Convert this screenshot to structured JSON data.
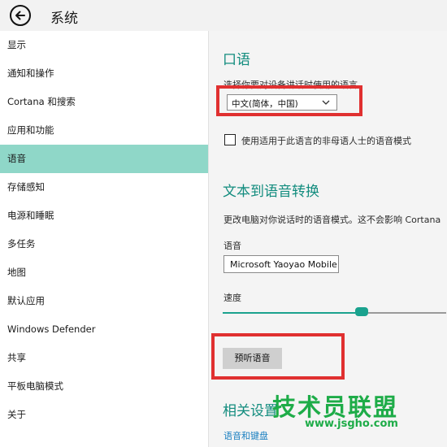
{
  "app": {
    "title": "系统"
  },
  "sidebar": {
    "items": [
      {
        "label": "显示"
      },
      {
        "label": "通知和操作"
      },
      {
        "label": "Cortana 和搜索"
      },
      {
        "label": "应用和功能"
      },
      {
        "label": "语音",
        "selected": true
      },
      {
        "label": "存储感知"
      },
      {
        "label": "电源和睡眠"
      },
      {
        "label": "多任务"
      },
      {
        "label": "地图"
      },
      {
        "label": "默认应用"
      },
      {
        "label": "Windows Defender"
      },
      {
        "label": "共享"
      },
      {
        "label": "平板电脑模式"
      },
      {
        "label": "关于"
      }
    ]
  },
  "speech": {
    "heading": "口语",
    "prompt": "选择你要对设备讲话时使用的语言",
    "language_value": "中文(简体，中国)",
    "checkbox_label": "使用适用于此语言的非母语人士的语音模式",
    "checkbox_checked": false
  },
  "tts": {
    "heading": "文本到语音转换",
    "description": "更改电脑对你说话时的语音模式。这不会影响 Cortana",
    "voice_label": "语音",
    "voice_value": "Microsoft Yaoyao Mobile",
    "speed_label": "速度",
    "speed_value": 0.62,
    "preview_button": "预听语音"
  },
  "related": {
    "heading": "相关设置",
    "link": "语音和键盘"
  },
  "watermark": {
    "text": "技术员联盟",
    "url": "www.jsgho.com"
  },
  "colors": {
    "accent": "#1aa28e",
    "selected_bg": "#8fd7c8",
    "highlight": "#e03030",
    "watermark": "#1eac48"
  }
}
